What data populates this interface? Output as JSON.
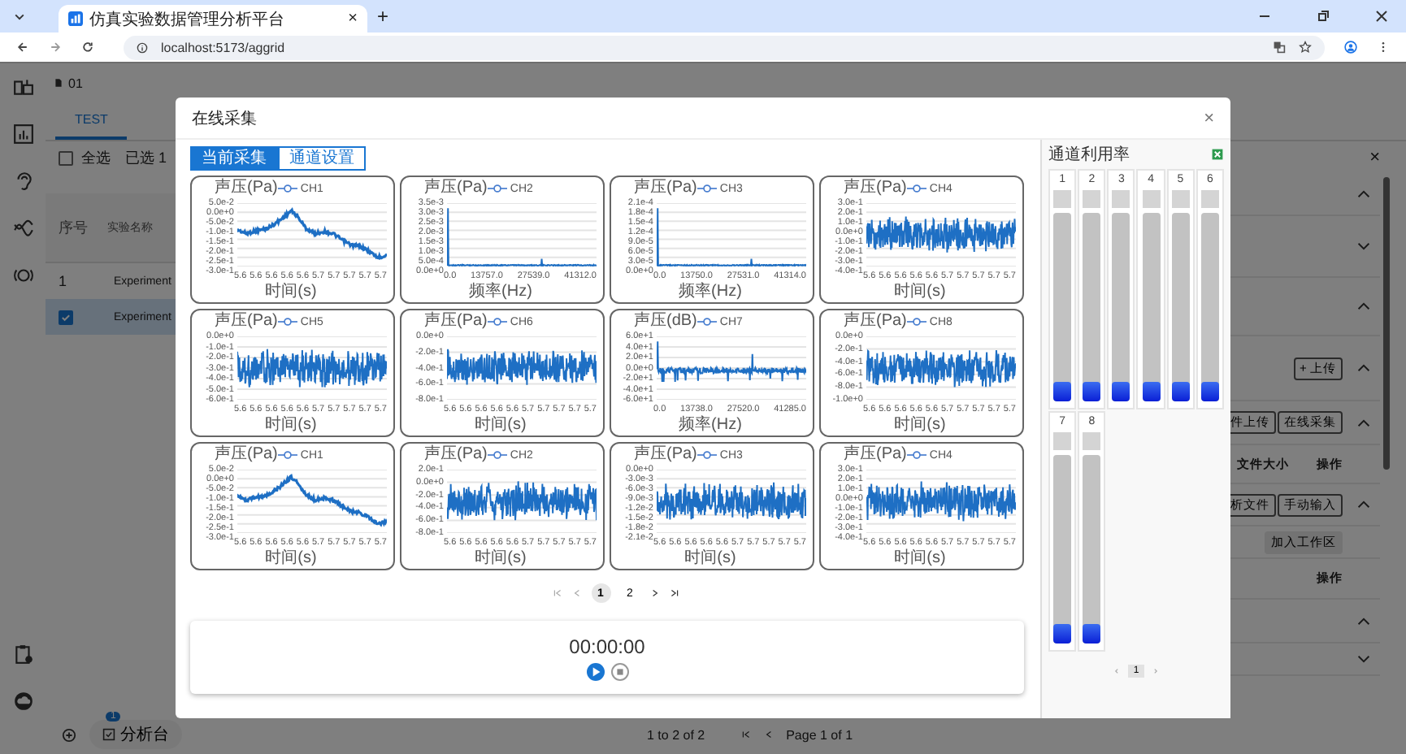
{
  "browser": {
    "tab_title": "仿真实验数据管理分析平台",
    "tab_close": "×",
    "new_tab": "+",
    "url": "localhost:5173/aggrid"
  },
  "app": {
    "breadcrumb": "01",
    "tabs": [
      {
        "label": "TEST",
        "selected": true
      }
    ],
    "select_all": {
      "label": "全选",
      "checked": false
    },
    "selected_count": "已选 1",
    "close": "×",
    "table": {
      "columns": [
        "序号",
        "实验名称"
      ],
      "rows": [
        {
          "kind": "number",
          "index": "1",
          "name": "Experiment",
          "selected": false
        },
        {
          "kind": "checkbox",
          "checked": true,
          "name": "Experiment",
          "selected": true
        }
      ]
    },
    "right_panel": [
      {
        "kind": "toggle",
        "expanded": true
      },
      {
        "kind": "toggle",
        "expanded": false
      },
      {
        "kind": "toggle",
        "expanded": true
      },
      {
        "kind": "actions",
        "expanded": true,
        "buttons": [
          {
            "label": "+ 上传",
            "kind": "outline"
          }
        ]
      },
      {
        "kind": "actions",
        "expanded": true,
        "buttons": [
          {
            "label": "件上传",
            "kind": "partial"
          },
          {
            "label": "在线采集",
            "kind": "outline"
          }
        ]
      },
      {
        "kind": "header",
        "cells": [
          "文件大小",
          "操作"
        ]
      },
      {
        "kind": "actions",
        "expanded": true,
        "buttons": [
          {
            "label": "析文件",
            "kind": "partial"
          },
          {
            "label": "手动输入",
            "kind": "outline"
          }
        ]
      },
      {
        "kind": "actions",
        "buttons": [
          {
            "label": "加入工作区",
            "kind": "filled"
          }
        ]
      },
      {
        "kind": "header",
        "cells": [
          "操作"
        ]
      },
      {
        "kind": "toggle",
        "expanded": true
      },
      {
        "kind": "toggle",
        "expanded": false
      }
    ],
    "footer": {
      "workbench": "分析台",
      "badge": "1",
      "range": "1 to 2 of 2",
      "page": "Page 1 of 1"
    }
  },
  "dialog": {
    "title": "在线采集",
    "close": "×",
    "tabs": [
      {
        "label": "当前采集",
        "selected": true
      },
      {
        "label": "通道设置",
        "selected": false
      }
    ],
    "charts": [
      {
        "series": "CH1",
        "kind": "trend",
        "ylabel": "声压(Pa)",
        "yticks": [
          "5.0e-2",
          "0.0e+0",
          "-5.0e-2",
          "-1.0e-1",
          "-1.5e-1",
          "-2.0e-1",
          "-2.5e-1",
          "-3.0e-1"
        ],
        "xticks": [
          "5.6",
          "5.6",
          "5.6",
          "5.6",
          "5.6",
          "5.7",
          "5.7",
          "5.7",
          "5.7",
          "5.7"
        ],
        "xlabel": "时间(s)"
      },
      {
        "series": "CH2",
        "kind": "spectrum",
        "ylabel": "声压(Pa)",
        "yticks": [
          "3.5e-3",
          "3.0e-3",
          "2.5e-3",
          "2.0e-3",
          "1.5e-3",
          "1.0e-3",
          "5.0e-4",
          "0.0e+0"
        ],
        "xticks": [
          "0.0",
          "13757.0",
          "27539.0",
          "41312.0"
        ],
        "xlabel": "频率(Hz)"
      },
      {
        "series": "CH3",
        "kind": "spectrum",
        "ylabel": "声压(Pa)",
        "yticks": [
          "2.1e-4",
          "1.8e-4",
          "1.5e-4",
          "1.2e-4",
          "9.0e-5",
          "6.0e-5",
          "3.0e-5",
          "0.0e+0"
        ],
        "xticks": [
          "0.0",
          "13750.0",
          "27531.0",
          "41314.0"
        ],
        "xlabel": "频率(Hz)"
      },
      {
        "series": "CH4",
        "kind": "noise",
        "ylabel": "声压(Pa)",
        "yticks": [
          "3.0e-1",
          "2.0e-1",
          "1.0e-1",
          "0.0e+0",
          "-1.0e-1",
          "-2.0e-1",
          "-3.0e-1",
          "-4.0e-1"
        ],
        "xticks": [
          "5.6",
          "5.6",
          "5.6",
          "5.6",
          "5.6",
          "5.7",
          "5.7",
          "5.7",
          "5.7",
          "5.7"
        ],
        "xlabel": "时间(s)"
      },
      {
        "series": "CH5",
        "kind": "noise",
        "ylabel": "声压(Pa)",
        "yticks": [
          "0.0e+0",
          "-1.0e-1",
          "-2.0e-1",
          "-3.0e-1",
          "-4.0e-1",
          "-5.0e-1",
          "-6.0e-1"
        ],
        "xticks": [
          "5.6",
          "5.6",
          "5.6",
          "5.6",
          "5.6",
          "5.7",
          "5.7",
          "5.7",
          "5.7",
          "5.7"
        ],
        "xlabel": "时间(s)"
      },
      {
        "series": "CH6",
        "kind": "noise",
        "ylabel": "声压(Pa)",
        "yticks": [
          "0.0e+0",
          "-2.0e-1",
          "-4.0e-1",
          "-6.0e-1",
          "-8.0e-1"
        ],
        "xticks": [
          "5.6",
          "5.6",
          "5.6",
          "5.6",
          "5.6",
          "5.7",
          "5.7",
          "5.7",
          "5.7",
          "5.7"
        ],
        "xlabel": "时间(s)"
      },
      {
        "series": "CH7",
        "kind": "spectrum-db",
        "ylabel": "声压(dB)",
        "yticks": [
          "6.0e+1",
          "4.0e+1",
          "2.0e+1",
          "0.0e+0",
          "-2.0e+1",
          "-4.0e+1",
          "-6.0e+1"
        ],
        "xticks": [
          "0.0",
          "13738.0",
          "27520.0",
          "41285.0"
        ],
        "xlabel": "频率(Hz)"
      },
      {
        "series": "CH8",
        "kind": "noise",
        "ylabel": "声压(Pa)",
        "yticks": [
          "0.0e+0",
          "-2.0e-1",
          "-4.0e-1",
          "-6.0e-1",
          "-8.0e-1",
          "-1.0e+0"
        ],
        "xticks": [
          "5.6",
          "5.6",
          "5.6",
          "5.6",
          "5.6",
          "5.7",
          "5.7",
          "5.7",
          "5.7",
          "5.7"
        ],
        "xlabel": "时间(s)"
      },
      {
        "series": "CH1",
        "kind": "trend",
        "ylabel": "声压(Pa)",
        "yticks": [
          "5.0e-2",
          "0.0e+0",
          "-5.0e-2",
          "-1.0e-1",
          "-1.5e-1",
          "-2.0e-1",
          "-2.5e-1",
          "-3.0e-1"
        ],
        "xticks": [
          "5.6",
          "5.6",
          "5.6",
          "5.6",
          "5.6",
          "5.7",
          "5.7",
          "5.7",
          "5.7",
          "5.7"
        ],
        "xlabel": "时间(s)"
      },
      {
        "series": "CH2",
        "kind": "noise",
        "ylabel": "声压(Pa)",
        "yticks": [
          "2.0e-1",
          "0.0e+0",
          "-2.0e-1",
          "-4.0e-1",
          "-6.0e-1",
          "-8.0e-1"
        ],
        "xticks": [
          "5.6",
          "5.6",
          "5.6",
          "5.6",
          "5.6",
          "5.7",
          "5.7",
          "5.7",
          "5.7",
          "5.7"
        ],
        "xlabel": "时间(s)"
      },
      {
        "series": "CH3",
        "kind": "noise",
        "ylabel": "声压(Pa)",
        "yticks": [
          "0.0e+0",
          "-3.0e-3",
          "-6.0e-3",
          "-9.0e-3",
          "-1.2e-2",
          "-1.5e-2",
          "-1.8e-2",
          "-2.1e-2"
        ],
        "xticks": [
          "5.6",
          "5.6",
          "5.6",
          "5.6",
          "5.6",
          "5.7",
          "5.7",
          "5.7",
          "5.7",
          "5.7"
        ],
        "xlabel": "时间(s)"
      },
      {
        "series": "CH4",
        "kind": "noise",
        "ylabel": "声压(Pa)",
        "yticks": [
          "3.0e-1",
          "2.0e-1",
          "1.0e-1",
          "0.0e+0",
          "-1.0e-1",
          "-2.0e-1",
          "-3.0e-1",
          "-4.0e-1"
        ],
        "xticks": [
          "5.6",
          "5.6",
          "5.6",
          "5.6",
          "5.6",
          "5.7",
          "5.7",
          "5.7",
          "5.7",
          "5.7"
        ],
        "xlabel": "时间(s)"
      }
    ],
    "chart_pager": [
      {
        "label": "1",
        "selected": true
      },
      {
        "label": "2",
        "selected": false
      }
    ],
    "timer": "00:00:00",
    "channel_panel": {
      "title": "通道利用率",
      "channels": [
        {
          "label": "1",
          "level": 0.1
        },
        {
          "label": "2",
          "level": 0.1
        },
        {
          "label": "3",
          "level": 0.1
        },
        {
          "label": "4",
          "level": 0.1
        },
        {
          "label": "5",
          "level": 0.1
        },
        {
          "label": "6",
          "level": 0.1
        },
        {
          "label": "7",
          "level": 0.1
        },
        {
          "label": "8",
          "level": 0.1
        }
      ],
      "pager": [
        {
          "label": "1",
          "selected": true
        }
      ]
    }
  }
}
